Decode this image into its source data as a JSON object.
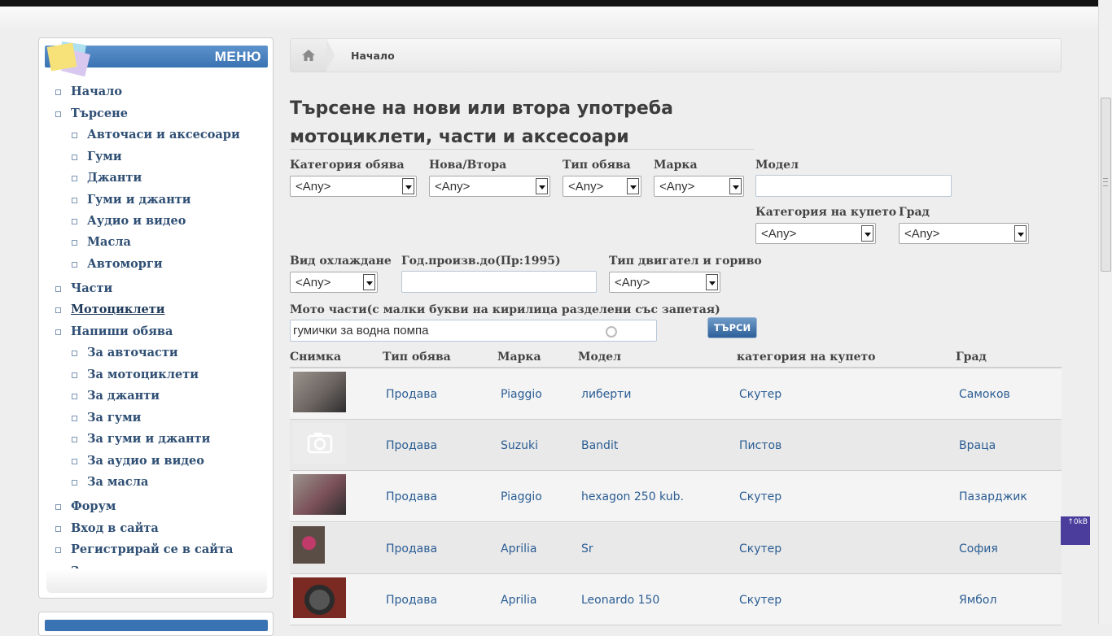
{
  "sidebar": {
    "title": "МЕНЮ",
    "items": [
      {
        "label": "Начало",
        "level": 0
      },
      {
        "label": "Търсене",
        "level": 0
      },
      {
        "label": "Авточаси и аксесоари",
        "level": 1
      },
      {
        "label": "Гуми",
        "level": 1
      },
      {
        "label": "Джанти",
        "level": 1
      },
      {
        "label": "Гуми и джанти",
        "level": 1
      },
      {
        "label": "Аудио и видео",
        "level": 1
      },
      {
        "label": "Масла",
        "level": 1
      },
      {
        "label": "Автоморги",
        "level": 1
      },
      {
        "label": "Части",
        "level": 0
      },
      {
        "label": "Мотоциклети",
        "level": 0,
        "active": true
      },
      {
        "label": "Напиши обява",
        "level": 0
      },
      {
        "label": "За авточасти",
        "level": 1
      },
      {
        "label": "За мотоциклети",
        "level": 1
      },
      {
        "label": "За джанти",
        "level": 1
      },
      {
        "label": "За гуми",
        "level": 1
      },
      {
        "label": "За гуми и джанти",
        "level": 1
      },
      {
        "label": "За аудио и видео",
        "level": 1
      },
      {
        "label": "За масла",
        "level": 1
      },
      {
        "label": "Форум",
        "level": 0
      },
      {
        "label": "Вход в сайта",
        "level": 0
      },
      {
        "label": "Регистрирай се в сайта",
        "level": 0
      },
      {
        "label": "За контакт",
        "level": 0
      }
    ]
  },
  "breadcrumb": {
    "home_icon": "home-icon",
    "current": "Начало"
  },
  "page": {
    "title_line1": "Търсене на нови или втора употреба",
    "title_line2": "мотоциклети, части и аксесоари"
  },
  "filters": {
    "category_label": "Категория обява",
    "category_value": "<Any>",
    "condition_label": "Нова/Втора",
    "condition_value": "<Any>",
    "type_label": "Тип обява",
    "type_value": "<Any>",
    "brand_label": "Марка",
    "brand_value": "<Any>",
    "model_label": "Модел",
    "model_value": "",
    "body_label": "Категория на купето",
    "body_value": "<Any>",
    "city_label": "Град",
    "city_value": "<Any>",
    "cooling_label": "Вид охлаждане",
    "cooling_value": "<Any>",
    "year_label": "Год.произв.до(Пр:1995)",
    "year_value": "",
    "engine_label": "Тип двигател и гориво",
    "engine_value": "<Any>",
    "parts_label": "Мото части(с малки букви на кирилица разделени със запетая)",
    "parts_value": "гумички за водна помпа",
    "search_button": "ТЪРСИ"
  },
  "table": {
    "headers": [
      "Снимка",
      "Тип обява",
      "Марка",
      "Модел",
      "категория на купето",
      "Град"
    ],
    "rows": [
      {
        "type": "Продава",
        "brand": "Piaggio",
        "model": "либерти",
        "body": "Скутер",
        "city": "Самоков",
        "photo": "scooter-photo"
      },
      {
        "type": "Продава",
        "brand": "Suzuki",
        "model": "Bandit",
        "body": "Пистов",
        "city": "Враца",
        "photo": "no-photo-camera-icon"
      },
      {
        "type": "Продава",
        "brand": "Piaggio",
        "model": "hexagon 250 kub.",
        "body": "Скутер",
        "city": "Пазарджик",
        "photo": "scooter-photo"
      },
      {
        "type": "Продава",
        "brand": "Aprilia",
        "model": "Sr",
        "body": "Скутер",
        "city": "София",
        "photo": "scooter-photo"
      },
      {
        "type": "Продава",
        "brand": "Aprilia",
        "model": "Leonardo 150",
        "body": "Скутер",
        "city": "Ямбол",
        "photo": "part-photo"
      }
    ]
  },
  "widget": {
    "label": "↑0kB"
  },
  "colors": {
    "accent": "#3a73b3",
    "link": "#2b5d93",
    "menu_text": "#2f4f74"
  }
}
